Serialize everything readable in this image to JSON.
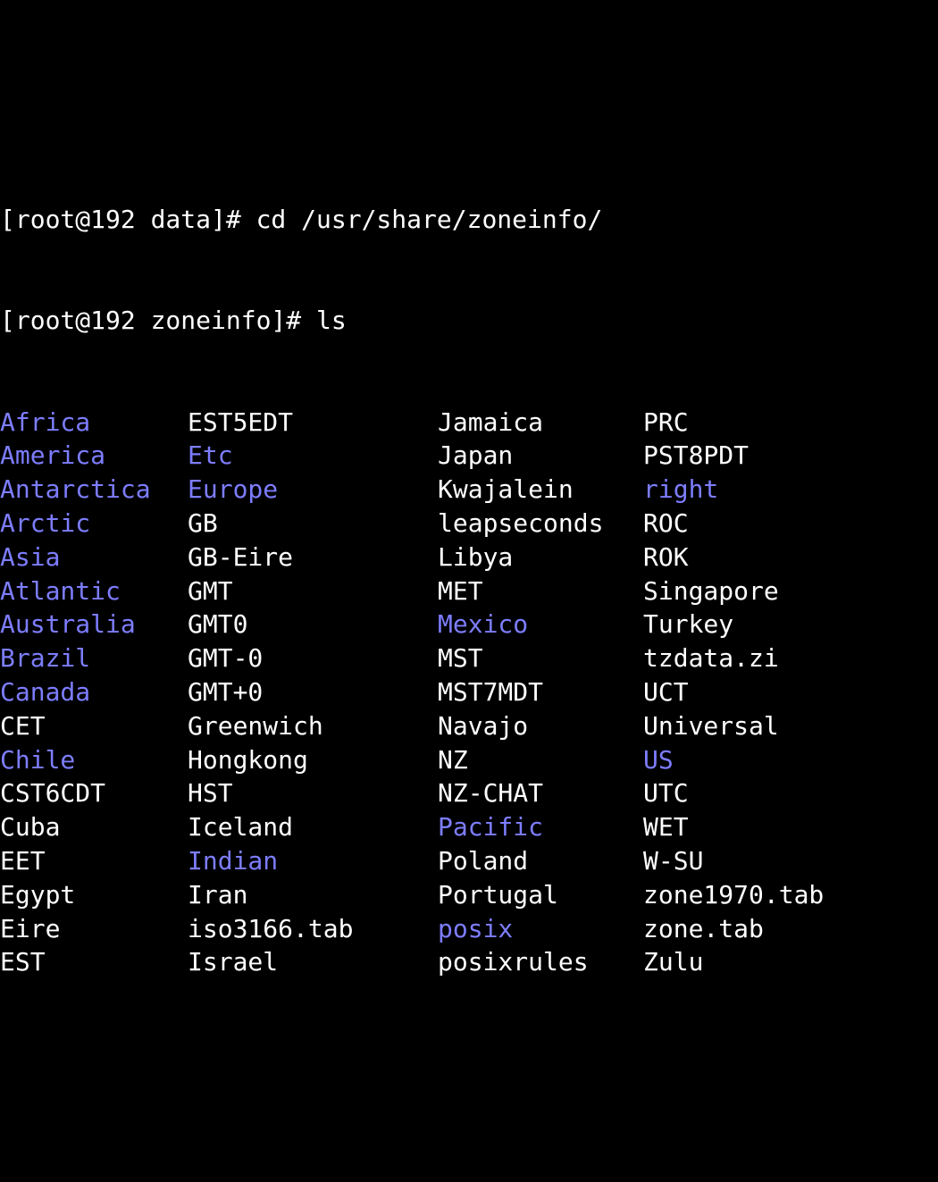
{
  "prompt_top": "[root@192 data]# cd /usr/share/zoneinfo/",
  "prompt_ls": "[root@192 zoneinfo]# ls",
  "listing": [
    [
      {
        "name": "Africa",
        "type": "dir"
      },
      {
        "name": "EST5EDT",
        "type": "file"
      },
      {
        "name": "Jamaica",
        "type": "file"
      },
      {
        "name": "PRC",
        "type": "file"
      }
    ],
    [
      {
        "name": "America",
        "type": "dir"
      },
      {
        "name": "Etc",
        "type": "dir"
      },
      {
        "name": "Japan",
        "type": "file"
      },
      {
        "name": "PST8PDT",
        "type": "file"
      }
    ],
    [
      {
        "name": "Antarctica",
        "type": "dir"
      },
      {
        "name": "Europe",
        "type": "dir"
      },
      {
        "name": "Kwajalein",
        "type": "file"
      },
      {
        "name": "right",
        "type": "dir"
      }
    ],
    [
      {
        "name": "Arctic",
        "type": "dir"
      },
      {
        "name": "GB",
        "type": "file"
      },
      {
        "name": "leapseconds",
        "type": "file"
      },
      {
        "name": "ROC",
        "type": "file"
      }
    ],
    [
      {
        "name": "Asia",
        "type": "dir"
      },
      {
        "name": "GB-Eire",
        "type": "file"
      },
      {
        "name": "Libya",
        "type": "file"
      },
      {
        "name": "ROK",
        "type": "file"
      }
    ],
    [
      {
        "name": "Atlantic",
        "type": "dir"
      },
      {
        "name": "GMT",
        "type": "file"
      },
      {
        "name": "MET",
        "type": "file"
      },
      {
        "name": "Singapore",
        "type": "file"
      }
    ],
    [
      {
        "name": "Australia",
        "type": "dir"
      },
      {
        "name": "GMT0",
        "type": "file"
      },
      {
        "name": "Mexico",
        "type": "dir"
      },
      {
        "name": "Turkey",
        "type": "file"
      }
    ],
    [
      {
        "name": "Brazil",
        "type": "dir"
      },
      {
        "name": "GMT-0",
        "type": "file"
      },
      {
        "name": "MST",
        "type": "file"
      },
      {
        "name": "tzdata.zi",
        "type": "file"
      }
    ],
    [
      {
        "name": "Canada",
        "type": "dir"
      },
      {
        "name": "GMT+0",
        "type": "file"
      },
      {
        "name": "MST7MDT",
        "type": "file"
      },
      {
        "name": "UCT",
        "type": "file"
      }
    ],
    [
      {
        "name": "CET",
        "type": "file"
      },
      {
        "name": "Greenwich",
        "type": "file"
      },
      {
        "name": "Navajo",
        "type": "file"
      },
      {
        "name": "Universal",
        "type": "file"
      }
    ],
    [
      {
        "name": "Chile",
        "type": "dir"
      },
      {
        "name": "Hongkong",
        "type": "file"
      },
      {
        "name": "NZ",
        "type": "file"
      },
      {
        "name": "US",
        "type": "dir"
      }
    ],
    [
      {
        "name": "CST6CDT",
        "type": "file"
      },
      {
        "name": "HST",
        "type": "file"
      },
      {
        "name": "NZ-CHAT",
        "type": "file"
      },
      {
        "name": "UTC",
        "type": "file"
      }
    ],
    [
      {
        "name": "Cuba",
        "type": "file"
      },
      {
        "name": "Iceland",
        "type": "file"
      },
      {
        "name": "Pacific",
        "type": "dir"
      },
      {
        "name": "WET",
        "type": "file"
      }
    ],
    [
      {
        "name": "EET",
        "type": "file"
      },
      {
        "name": "Indian",
        "type": "dir"
      },
      {
        "name": "Poland",
        "type": "file"
      },
      {
        "name": "W-SU",
        "type": "file"
      }
    ],
    [
      {
        "name": "Egypt",
        "type": "file"
      },
      {
        "name": "Iran",
        "type": "file"
      },
      {
        "name": "Portugal",
        "type": "file"
      },
      {
        "name": "zone1970.tab",
        "type": "file"
      }
    ],
    [
      {
        "name": "Eire",
        "type": "file"
      },
      {
        "name": "iso3166.tab",
        "type": "file"
      },
      {
        "name": "posix",
        "type": "dir"
      },
      {
        "name": "zone.tab",
        "type": "file"
      }
    ],
    [
      {
        "name": "EST",
        "type": "file"
      },
      {
        "name": "Israel",
        "type": "file"
      },
      {
        "name": "posixrules",
        "type": "file"
      },
      {
        "name": "Zulu",
        "type": "file"
      }
    ]
  ]
}
